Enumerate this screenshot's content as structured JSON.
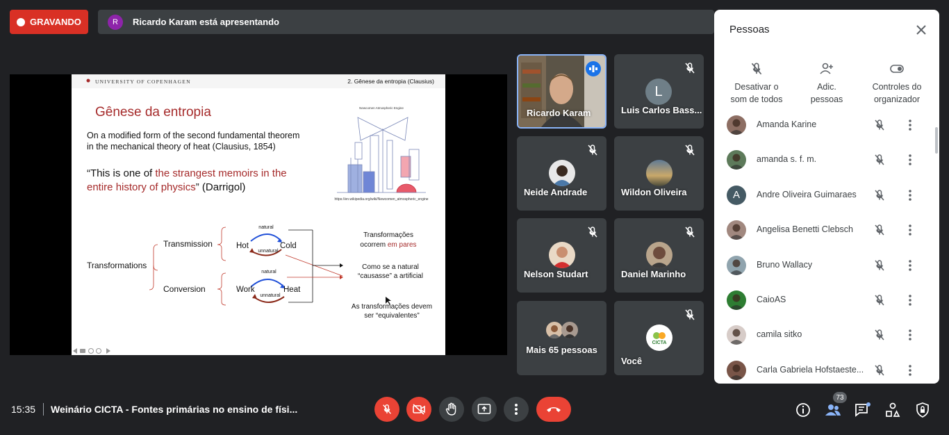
{
  "recording": {
    "label": "GRAVANDO"
  },
  "presentation": {
    "presenter_initial": "R",
    "banner": "Ricardo Karam está apresentando"
  },
  "slide": {
    "university": "UNIVERSITY OF COPENHAGEN",
    "section": "2. Gênese da entropia (Clausius)",
    "title": "Gênese da entropia",
    "line1": "On a modified form of the second fundamental theorem",
    "line2": "in the mechanical theory of heat (Clausius, 1854)",
    "quote_start": "“This is one of ",
    "quote_red1": "the strangest memoirs in the",
    "quote_red2": "entire history of physics",
    "quote_end": "” (Darrigol)",
    "engine_caption": "Newcomen Atmospheric Engine",
    "engine_url": "https://en.wikipedia.org/wiki/Newcomen_atmospheric_engine",
    "transformations": "Transformations",
    "transmission": "Transmission",
    "conversion": "Conversion",
    "hot": "Hot",
    "cold": "Cold",
    "work": "Work",
    "heat": "Heat",
    "natural": "natural",
    "unnatural": "unnatural",
    "note1a": "Transformações",
    "note1b": "ocorrem ",
    "note1c": "em pares",
    "note2a": "Como se a natural",
    "note2b": "“causasse” a artificial",
    "note3a": "As transformações devem",
    "note3b": "ser “equivalentes”"
  },
  "tiles": {
    "ricardo": "Ricardo Karam",
    "luis": "Luis Carlos Bass...",
    "luis_initial": "L",
    "neide": "Neide Andrade",
    "wildon": "Wildon Oliveira",
    "nelson": "Nelson Studart",
    "daniel": "Daniel Marinho",
    "more": "Mais 65 pessoas",
    "voce": "Você",
    "cicta": "CICTA"
  },
  "panel": {
    "title": "Pessoas",
    "mute_all": [
      "Desativar o",
      "som de todos"
    ],
    "add_people": [
      "Adic.",
      "pessoas"
    ],
    "host_controls": [
      "Controles do",
      "organizador"
    ],
    "people": [
      {
        "name": "Amanda Karine",
        "color": "#8d6e63"
      },
      {
        "name": "amanda s. f. m.",
        "color": "#5d7a5a"
      },
      {
        "name": "Andre Oliveira Guimaraes",
        "initial": "A",
        "color": "#455a64"
      },
      {
        "name": "Angelisa Benetti Clebsch",
        "color": "#a1887f"
      },
      {
        "name": "Bruno Wallacy",
        "color": "#90a4ae"
      },
      {
        "name": "CaioAS",
        "color": "#2e7d32"
      },
      {
        "name": "camila sitko",
        "color": "#d7ccc8"
      },
      {
        "name": "Carla Gabriela Hofstaeste...",
        "color": "#795548"
      }
    ]
  },
  "bottom": {
    "time": "15:35",
    "meeting": "Weinário CICTA - Fontes primárias no ensino de físi...",
    "participant_count": "73"
  },
  "colors": {
    "red": "#ea4335",
    "accent": "#1a73e8",
    "bg": "#202124",
    "tile": "#3c4043",
    "slide_red": "#a52a2a"
  }
}
